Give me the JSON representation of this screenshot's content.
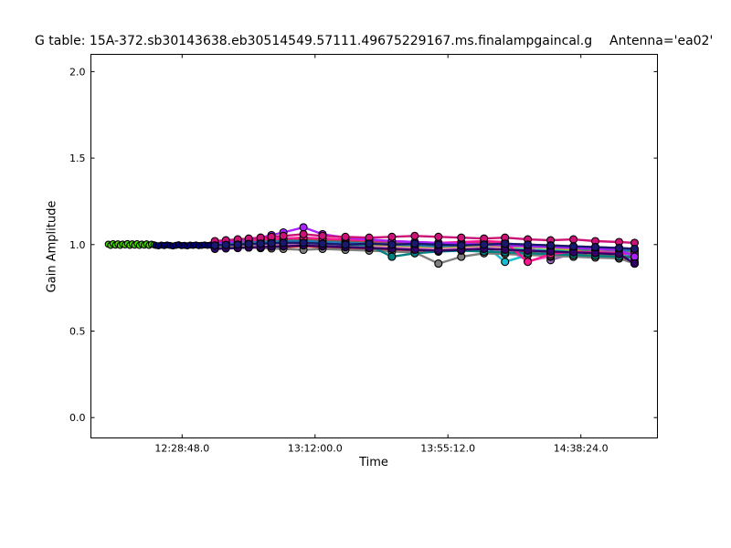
{
  "chart_data": {
    "type": "line",
    "title": "G table: 15A-372.sb30143638.eb30514549.57111.49675229167.ms.finalampgaincal.g",
    "annotation": "Antenna='ea02'",
    "xlabel": "Time",
    "ylabel": "Gain Amplitude",
    "x_axis": {
      "unit": "seconds-of-day",
      "lim": [
        43149,
        54198
      ],
      "ticks": [
        {
          "t": 44928,
          "label": "12:28:48.0"
        },
        {
          "t": 47520,
          "label": "13:12:00.0"
        },
        {
          "t": 50112,
          "label": "13:55:12.0"
        },
        {
          "t": 52704,
          "label": "14:38:24.0"
        }
      ]
    },
    "y_axis": {
      "lim": [
        -0.118,
        2.1
      ],
      "ticks": [
        {
          "v": 0.0,
          "label": "0.0"
        },
        {
          "v": 0.5,
          "label": "0.5"
        },
        {
          "v": 1.0,
          "label": "1.0"
        },
        {
          "v": 1.5,
          "label": "1.5"
        },
        {
          "v": 2.0,
          "label": "2.0"
        }
      ]
    },
    "grid": false,
    "legend": "none",
    "marker": "circle-black-edge",
    "prefix_series": [
      {
        "name": "dense-run-green",
        "color": "#46d900",
        "times": [
          43487,
          43534,
          43581,
          43628,
          43674,
          43721,
          43768,
          43815,
          43862,
          43908,
          43955,
          44002,
          44049,
          44096,
          44142,
          44189,
          44236,
          44283,
          44330,
          44376
        ],
        "values": [
          1.002,
          0.996,
          1.005,
          0.997,
          1.004,
          0.995,
          1.003,
          0.998,
          1.006,
          0.996,
          1.004,
          0.997,
          1.005,
          0.995,
          1.003,
          0.997,
          1.004,
          0.996,
          1.002,
          0.999
        ]
      },
      {
        "name": "dense-run-navy",
        "color": "#000080",
        "times": [
          44410,
          44466,
          44523,
          44579,
          44635,
          44691,
          44748,
          44804,
          44860,
          44917,
          44973,
          45029,
          45085,
          45142,
          45198,
          45254,
          45311,
          45367,
          45423,
          45480
        ],
        "values": [
          0.996,
          0.993,
          0.997,
          0.994,
          0.998,
          0.995,
          0.992,
          0.996,
          0.999,
          0.994,
          0.996,
          0.993,
          0.997,
          0.995,
          0.998,
          0.994,
          0.996,
          0.998,
          0.995,
          0.997
        ]
      }
    ],
    "cluster_times": [
      45568,
      45782,
      46013,
      46227,
      46458,
      46671,
      46902,
      47294,
      47667,
      48112,
      48575,
      49019,
      49464,
      49927,
      50371,
      50816,
      51225,
      51670,
      52115,
      52560,
      52987,
      53449,
      53752
    ],
    "series": [
      {
        "name": "series-01",
        "color": "#00b5ad",
        "values": [
          1.0,
          1.003,
          1.005,
          1.008,
          1.01,
          1.008,
          1.005,
          1.0,
          1.0,
          0.995,
          0.99,
          0.985,
          0.98,
          0.985,
          0.99,
          0.985,
          0.975,
          0.97,
          0.965,
          0.97,
          0.96,
          0.955,
          0.95
        ]
      },
      {
        "name": "series-02",
        "color": "#2ca02c",
        "values": [
          0.995,
          0.998,
          1.0,
          1.003,
          1.005,
          1.008,
          1.01,
          1.01,
          1.005,
          1.0,
          1.0,
          0.995,
          0.99,
          0.985,
          0.99,
          0.995,
          0.99,
          0.985,
          0.98,
          0.975,
          0.97,
          0.965,
          0.96
        ]
      },
      {
        "name": "series-03",
        "color": "#ff7f0e",
        "values": [
          1.005,
          1.008,
          1.01,
          1.013,
          1.015,
          1.018,
          1.02,
          1.025,
          1.02,
          1.015,
          1.01,
          1.005,
          1.0,
          0.995,
          1.0,
          1.005,
          1.0,
          0.995,
          0.99,
          0.985,
          0.98,
          0.92,
          0.93
        ]
      },
      {
        "name": "series-04",
        "color": "#d62728",
        "values": [
          0.99,
          0.988,
          0.985,
          0.983,
          0.98,
          0.983,
          0.985,
          0.99,
          0.985,
          0.98,
          0.975,
          0.97,
          0.965,
          0.96,
          0.97,
          0.975,
          0.97,
          0.96,
          0.95,
          0.945,
          0.94,
          0.935,
          0.93
        ]
      },
      {
        "name": "series-05",
        "color": "#9467bd",
        "values": [
          1.0,
          1.003,
          1.005,
          1.008,
          1.01,
          1.013,
          1.015,
          1.02,
          1.015,
          1.01,
          1.005,
          1.0,
          1.0,
          0.995,
          1.0,
          1.005,
          1.0,
          0.995,
          0.91,
          0.95,
          0.96,
          0.955,
          0.95
        ]
      },
      {
        "name": "series-06",
        "color": "#8c564b",
        "values": [
          1.01,
          1.013,
          1.015,
          1.018,
          1.02,
          1.023,
          1.025,
          1.03,
          1.025,
          1.02,
          1.015,
          1.01,
          1.005,
          1.0,
          1.005,
          1.01,
          1.005,
          1.0,
          0.995,
          0.99,
          0.985,
          0.98,
          0.975
        ]
      },
      {
        "name": "series-07",
        "color": "#e377c2",
        "values": [
          0.985,
          0.988,
          0.99,
          0.993,
          0.995,
          0.998,
          1.0,
          1.005,
          1.0,
          0.995,
          0.99,
          0.985,
          0.98,
          0.975,
          0.98,
          0.985,
          0.98,
          0.905,
          0.93,
          0.94,
          0.935,
          0.93,
          0.92
        ]
      },
      {
        "name": "series-08",
        "color": "#17becf",
        "values": [
          1.0,
          1.003,
          1.005,
          1.008,
          1.01,
          1.013,
          1.015,
          1.02,
          1.015,
          1.01,
          1.005,
          1.0,
          0.995,
          0.99,
          0.995,
          1.0,
          0.9,
          0.94,
          0.95,
          0.955,
          0.95,
          0.945,
          0.94
        ]
      },
      {
        "name": "series-09",
        "color": "#bcbd22",
        "values": [
          0.995,
          0.998,
          1.0,
          1.003,
          1.005,
          1.008,
          1.01,
          1.015,
          1.01,
          1.005,
          1.0,
          0.995,
          0.99,
          0.985,
          0.99,
          0.995,
          0.99,
          0.985,
          0.98,
          0.97,
          0.94,
          0.92,
          0.9
        ]
      },
      {
        "name": "series-10",
        "color": "#1f77b4",
        "values": [
          1.005,
          1.008,
          1.01,
          1.013,
          1.015,
          1.018,
          1.02,
          1.02,
          1.015,
          1.01,
          1.005,
          1.0,
          0.995,
          0.99,
          0.995,
          1.0,
          0.995,
          0.99,
          0.985,
          0.98,
          0.975,
          0.97,
          0.965
        ]
      },
      {
        "name": "series-11",
        "color": "#7f7f7f",
        "values": [
          0.99,
          0.988,
          0.985,
          0.983,
          0.98,
          0.978,
          0.975,
          0.97,
          0.975,
          0.97,
          0.965,
          0.96,
          0.955,
          0.89,
          0.93,
          0.95,
          0.945,
          0.94,
          0.935,
          0.93,
          0.925,
          0.92,
          0.89
        ]
      },
      {
        "name": "series-12",
        "color": "#008080",
        "values": [
          1.0,
          1.0,
          1.0,
          1.003,
          1.005,
          1.008,
          1.01,
          1.01,
          1.005,
          1.0,
          0.995,
          0.93,
          0.95,
          0.96,
          0.965,
          0.96,
          0.955,
          0.95,
          0.945,
          0.94,
          0.935,
          0.93,
          0.925
        ]
      },
      {
        "name": "series-13",
        "color": "#ff1493",
        "values": [
          1.015,
          1.018,
          1.02,
          1.025,
          1.03,
          1.033,
          1.035,
          1.04,
          1.035,
          1.03,
          1.025,
          1.02,
          1.015,
          1.01,
          1.015,
          1.02,
          1.015,
          0.9,
          0.945,
          0.96,
          0.955,
          0.95,
          0.945
        ]
      },
      {
        "name": "series-14",
        "color": "#aa22ff",
        "values": [
          1.01,
          1.015,
          1.02,
          1.03,
          1.04,
          1.055,
          1.07,
          1.1,
          1.06,
          1.04,
          1.03,
          1.02,
          1.015,
          1.01,
          1.005,
          1.0,
          0.995,
          0.99,
          0.985,
          0.98,
          0.975,
          0.97,
          0.93
        ]
      },
      {
        "name": "series-15",
        "color": "#cc1177",
        "values": [
          1.02,
          1.025,
          1.03,
          1.035,
          1.04,
          1.045,
          1.05,
          1.06,
          1.05,
          1.045,
          1.04,
          1.045,
          1.05,
          1.045,
          1.04,
          1.035,
          1.04,
          1.03,
          1.025,
          1.03,
          1.02,
          1.015,
          1.01
        ]
      },
      {
        "name": "series-16",
        "color": "#330066",
        "values": [
          0.975,
          0.978,
          0.98,
          0.983,
          0.985,
          0.988,
          0.99,
          0.995,
          0.99,
          0.985,
          0.98,
          0.975,
          0.97,
          0.965,
          0.97,
          0.975,
          0.97,
          0.965,
          0.96,
          0.955,
          0.95,
          0.945,
          0.89
        ]
      },
      {
        "name": "series-17",
        "color": "#191970",
        "values": [
          0.995,
          0.998,
          1.0,
          1.003,
          1.005,
          1.008,
          1.01,
          1.01,
          1.005,
          1.0,
          1.005,
          1.0,
          1.005,
          1.0,
          0.995,
          1.0,
          1.005,
          1.0,
          0.995,
          0.99,
          0.985,
          0.98,
          0.975
        ]
      }
    ]
  }
}
